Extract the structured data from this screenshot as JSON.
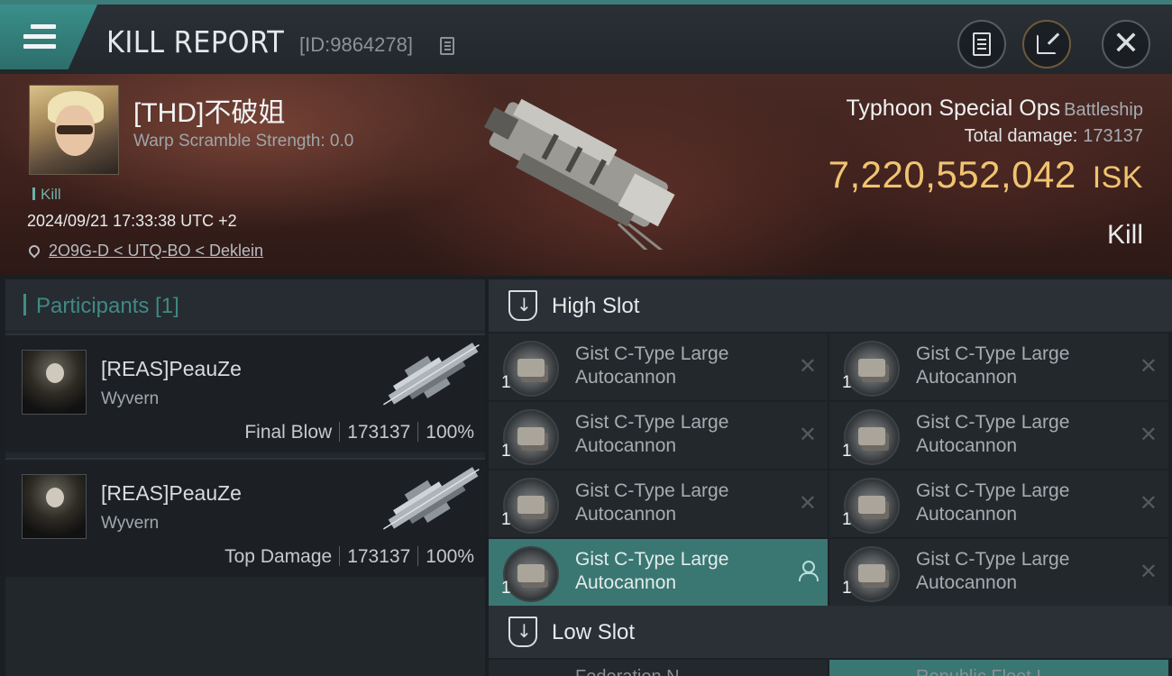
{
  "header": {
    "title": "KILL REPORT",
    "report_id": "[ID:9864278]"
  },
  "victim": {
    "name": "[THD]不破姐",
    "warp_scramble": "Warp Scramble Strength: 0.0",
    "tag": "Kill",
    "datetime": "2024/09/21 17:33:38 UTC +2",
    "location": "2O9G-D < UTQ-BO < Deklein",
    "ship_name": "Typhoon Special Ops",
    "ship_class": "Battleship",
    "total_damage_label": "Total damage:",
    "total_damage": "173137",
    "isk_value": "7,220,552,042",
    "isk_unit": "ISK",
    "result": "Kill"
  },
  "participants": {
    "header": "Participants [1]",
    "list": [
      {
        "name": "[REAS]PeauZe",
        "ship": "Wyvern",
        "role": "Final Blow",
        "damage": "173137",
        "percent": "100%"
      },
      {
        "name": "[REAS]PeauZe",
        "ship": "Wyvern",
        "role": "Top Damage",
        "damage": "173137",
        "percent": "100%"
      }
    ]
  },
  "slots": {
    "high": {
      "title": "High Slot",
      "modules": [
        {
          "line1": "Gist C-Type Large",
          "line2": "Autocannon",
          "qty": "1"
        },
        {
          "line1": "Gist C-Type Large",
          "line2": "Autocannon",
          "qty": "1"
        },
        {
          "line1": "Gist C-Type Large",
          "line2": "Autocannon",
          "qty": "1"
        },
        {
          "line1": "Gist C-Type Large",
          "line2": "Autocannon",
          "qty": "1"
        },
        {
          "line1": "Gist C-Type Large",
          "line2": "Autocannon",
          "qty": "1"
        },
        {
          "line1": "Gist C-Type Large",
          "line2": "Autocannon",
          "qty": "1"
        },
        {
          "line1": "Gist C-Type Large",
          "line2": "Autocannon",
          "qty": "1"
        },
        {
          "line1": "Gist C-Type Large",
          "line2": "Autocannon",
          "qty": "1"
        }
      ]
    },
    "low": {
      "title": "Low Slot",
      "partial": [
        "Federation N...",
        "Republic Fleet I..."
      ]
    }
  },
  "icons": {
    "menu": "hamburger-icon",
    "copy": "copy-icon",
    "clipboard": "clipboard-icon",
    "share": "share-icon",
    "close": "close-icon",
    "location": "location-pin-icon",
    "slot": "slot-shield-icon",
    "destroyed": "x-icon",
    "dropped": "person-icon"
  },
  "colors": {
    "accent": "#3f8f88",
    "isk": "#f0c470",
    "selected": "#3a7672"
  }
}
